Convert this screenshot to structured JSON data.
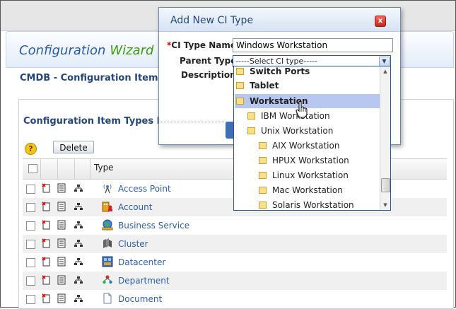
{
  "wizard": {
    "title_part1": "Configuration",
    "title_part2": "Wizard"
  },
  "page": {
    "breadcrumb": "CMDB -  Configuration Item T"
  },
  "list": {
    "title": "Configuration Item Types Lis",
    "help_label": "?",
    "delete_label": "Delete",
    "column_type": "Type",
    "rows": [
      {
        "name": "Access Point",
        "icon": "antenna-icon"
      },
      {
        "name": "Account",
        "icon": "account-icon"
      },
      {
        "name": "Business Service",
        "icon": "globe-icon"
      },
      {
        "name": "Cluster",
        "icon": "cluster-icon"
      },
      {
        "name": "Datacenter",
        "icon": "datacenter-icon"
      },
      {
        "name": "Department",
        "icon": "department-icon"
      },
      {
        "name": "Document",
        "icon": "document-icon"
      }
    ]
  },
  "dialog": {
    "title": "Add New CI Type",
    "close_label": "x",
    "required_mark": "*",
    "name_label": "CI Type Name",
    "name_value": "Windows Workstation",
    "parent_label": "Parent Type",
    "parent_value": "-----Select CI type-----",
    "description_label": "Description"
  },
  "dropdown": {
    "items": [
      {
        "label": "Switch Ports",
        "level": 0,
        "bold": true
      },
      {
        "label": "Tablet",
        "level": 0,
        "bold": true
      },
      {
        "label": "Workstation",
        "level": 0,
        "bold": true,
        "selected": true
      },
      {
        "label": "IBM Workstation",
        "level": 1
      },
      {
        "label": "Unix Workstation",
        "level": 1
      },
      {
        "label": "AIX Workstation",
        "level": 2
      },
      {
        "label": "HPUX Workstation",
        "level": 2
      },
      {
        "label": "Linux Workstation",
        "level": 2
      },
      {
        "label": "Mac Workstation",
        "level": 2
      },
      {
        "label": "Solaris Workstation",
        "level": 2
      }
    ]
  },
  "colors": {
    "link": "#2f5fa8",
    "heading": "#25467a",
    "wizard_green": "#3c9a12",
    "selection": "#b8c7f0"
  }
}
